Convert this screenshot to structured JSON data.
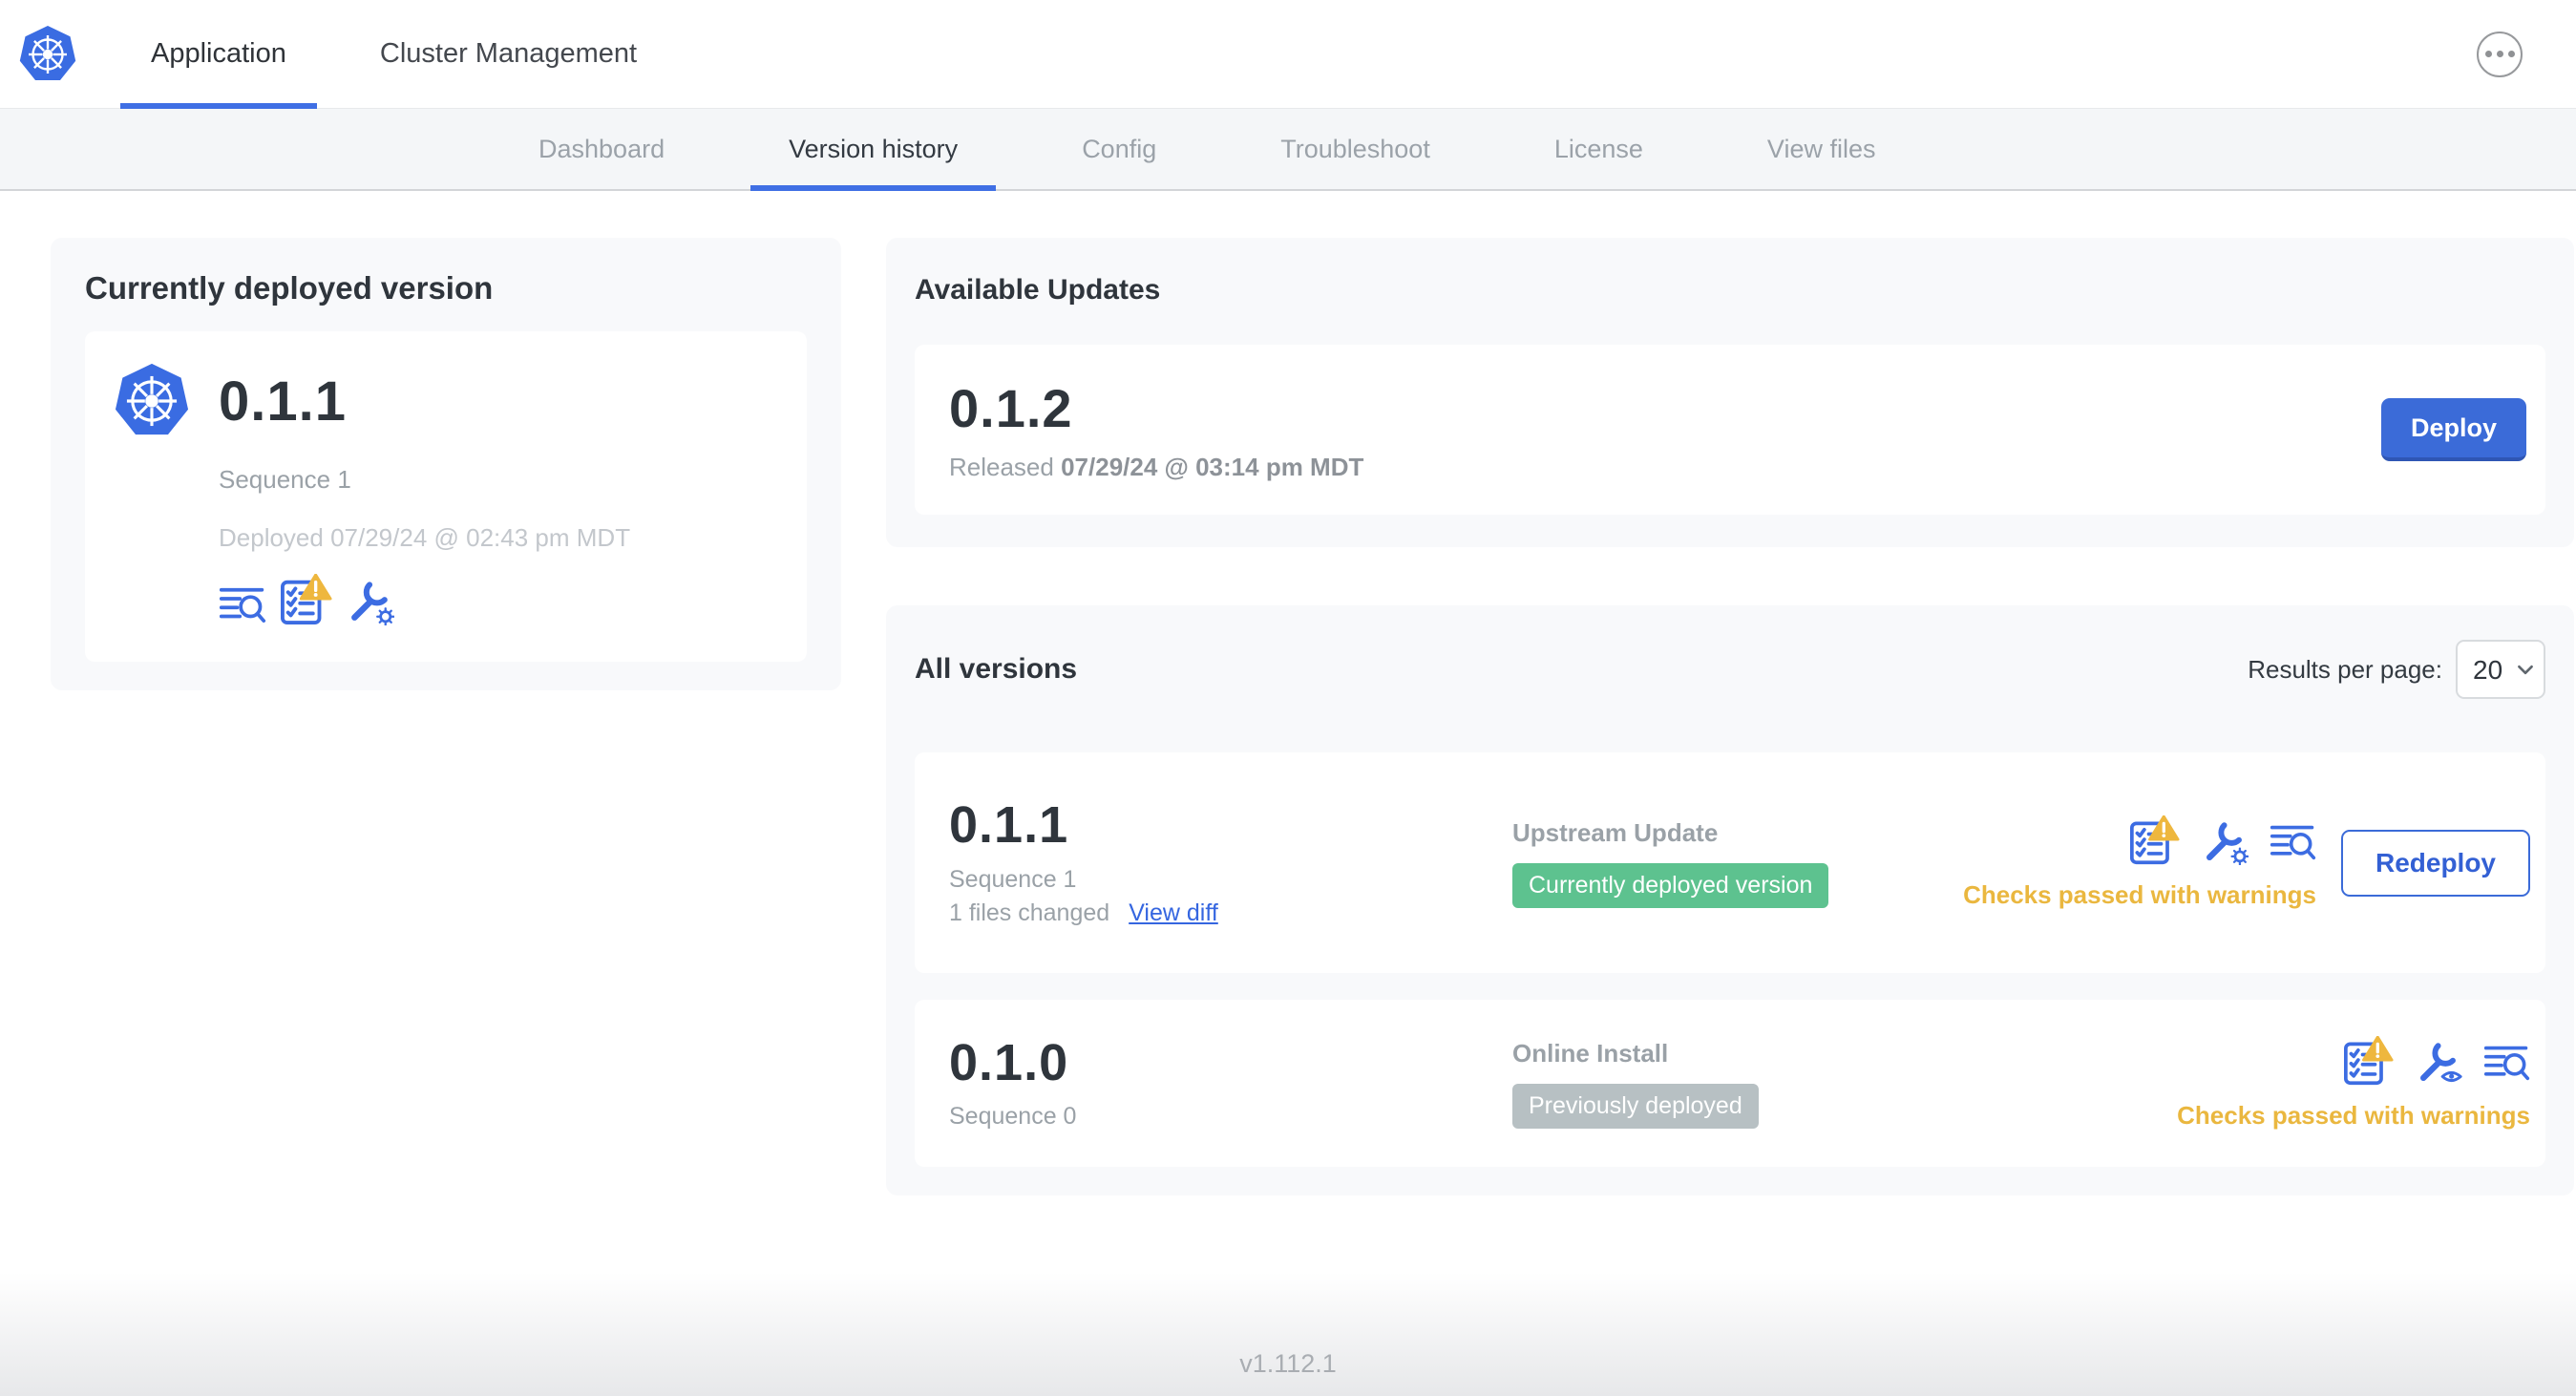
{
  "topnav": {
    "tabs": [
      {
        "label": "Application"
      },
      {
        "label": "Cluster Management"
      }
    ],
    "active_tab": "Application"
  },
  "subnav": {
    "items": [
      "Dashboard",
      "Version history",
      "Config",
      "Troubleshoot",
      "License",
      "View files"
    ],
    "active": "Version history"
  },
  "deployed_card": {
    "title": "Currently deployed version",
    "version": "0.1.1",
    "sequence": "Sequence 1",
    "deployed_at": "Deployed 07/29/24 @ 02:43 pm MDT"
  },
  "available_updates": {
    "title": "Available Updates",
    "version": "0.1.2",
    "released_label": "Released",
    "released_at": "07/29/24 @ 03:14 pm MDT",
    "deploy_label": "Deploy"
  },
  "all_versions": {
    "title": "All versions",
    "results_per_page_label": "Results per page:",
    "results_per_page_value": "20",
    "rows": [
      {
        "version": "0.1.1",
        "sequence": "Sequence 1",
        "files_changed": "1 files changed",
        "view_diff_label": "View diff",
        "source": "Upstream Update",
        "badge": "Currently deployed version",
        "badge_color": "#5dc28f",
        "status": "Checks passed with warnings",
        "action_label": "Redeploy"
      },
      {
        "version": "0.1.0",
        "sequence": "Sequence 0",
        "source": "Online Install",
        "badge": "Previously deployed",
        "badge_color": "#b7c0c3",
        "status": "Checks passed with warnings"
      }
    ]
  },
  "footer": {
    "version": "v1.112.1"
  },
  "icons": {
    "logo": "kubernetes-logo",
    "overflow": "ellipsis",
    "logs": "view-logs",
    "preflight": "preflight-checks-warning",
    "config_edit": "config-wrench-gear",
    "config_view": "config-wrench-eye",
    "select_chevron": "chevron-down"
  },
  "colors": {
    "accent_blue": "#3b6bd8",
    "link_blue": "#3566e0",
    "badge_green": "#5dc28f",
    "badge_gray": "#b7c0c3",
    "warning_gold": "#eab73f",
    "subnav_bg": "#f4f6f8",
    "panel_bg": "#f8f9fb"
  }
}
